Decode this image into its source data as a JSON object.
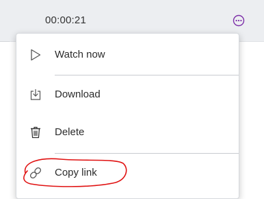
{
  "row": {
    "duration": "00:00:21"
  },
  "menu": {
    "items": [
      {
        "label": "Watch now",
        "icon": "play-icon"
      },
      {
        "label": "Download",
        "icon": "download-icon"
      },
      {
        "label": "Delete",
        "icon": "trash-icon"
      },
      {
        "label": "Copy link",
        "icon": "link-icon"
      }
    ]
  },
  "colors": {
    "accent": "#7c2ea8",
    "annotation": "#e01010",
    "row_background": "#eceef1",
    "text": "#2b2b2b",
    "icon": "#555555"
  }
}
